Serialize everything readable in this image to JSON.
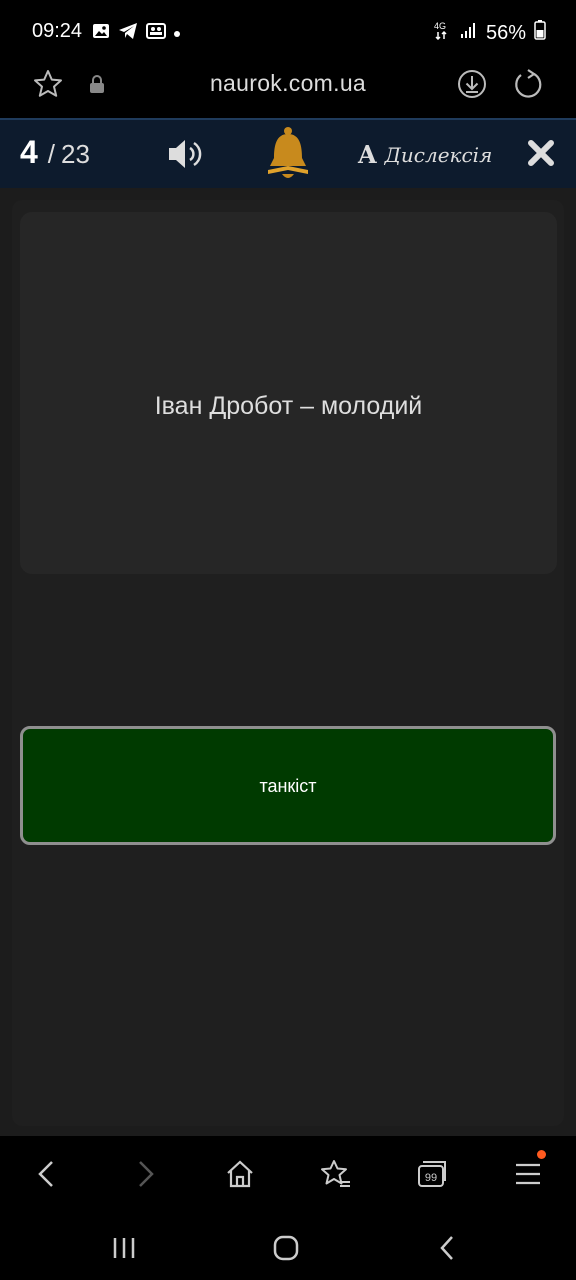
{
  "status_bar": {
    "time": "09:24",
    "network": "4G",
    "battery": "56%",
    "left_icons": [
      "gallery-icon",
      "telegram-icon",
      "teams-icon"
    ],
    "right_icons": [
      "network-4g-icon",
      "signal-icon",
      "battery-icon"
    ]
  },
  "browser": {
    "url": "naurok.com.ua",
    "left_icons": [
      "star-icon",
      "lock-icon"
    ],
    "right_icons": [
      "download-icon",
      "reload-icon"
    ]
  },
  "quiz_header": {
    "current": "4",
    "separator": "/",
    "total": "23",
    "dyslexia_letter": "A",
    "dyslexia_label": "Дислексія",
    "icons": [
      "speaker-icon",
      "bell-icon",
      "close-icon"
    ],
    "bell_color": "#c88a1d"
  },
  "question": {
    "text": "Іван Дробот – молодий"
  },
  "answers": {
    "selected_label": "танкіст",
    "selected_color": "#003a00"
  },
  "browser_nav": {
    "icons": [
      "back-icon",
      "forward-icon",
      "home-icon",
      "bookmarks-icon",
      "tabs-icon",
      "menu-icon"
    ],
    "tabs_count": "99"
  },
  "system_nav": {
    "icons": [
      "recents-icon",
      "home-circle-icon",
      "system-back-icon"
    ]
  }
}
